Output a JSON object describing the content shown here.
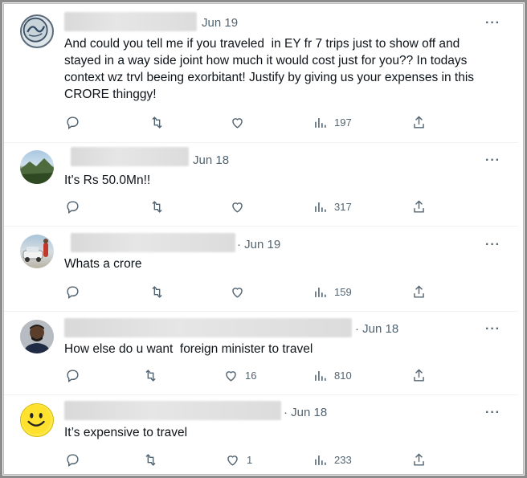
{
  "tweets": [
    {
      "date": "Jun 19",
      "text": "And could you tell me if you traveled  in EY fr 7 trips just to show off and stayed in a way side joint how much it would cost just for you?? In todays context wz trvl beeing exorbitant! Justify by giving us your expenses in this CRORE thinggy!",
      "likes": "",
      "views": "197",
      "avatar": "logo-avatar"
    },
    {
      "date": "Jun 18",
      "text": "It's Rs 50.0Mn!!",
      "likes": "",
      "views": "317",
      "avatar": "landscape-avatar"
    },
    {
      "date": "· Jun 19",
      "text": "Whats a crore",
      "likes": "",
      "views": "159",
      "avatar": "car-avatar"
    },
    {
      "date": "· Jun 18",
      "text": "How else do u want  foreign minister to travel",
      "likes": "16",
      "views": "810",
      "avatar": "person-avatar"
    },
    {
      "date": "· Jun 18",
      "text": "It’s expensive to travel",
      "likes": "1",
      "views": "233",
      "avatar": "smiley-avatar"
    }
  ],
  "more_label": "···",
  "colors": {
    "text": "#0f1419",
    "muted": "#536471",
    "divider": "#eff3f4"
  }
}
